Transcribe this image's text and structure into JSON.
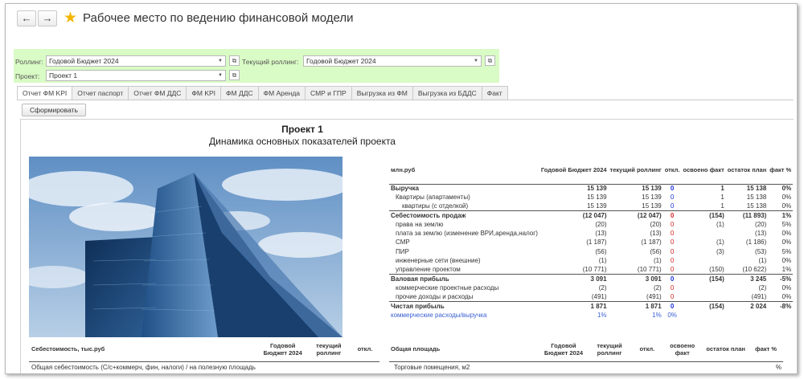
{
  "window": {
    "title": "Рабочее место по ведению финансовой модели",
    "back_icon": "←",
    "forward_icon": "→",
    "favorite_icon": "★"
  },
  "filters": {
    "rolling_label": "Роллинг:",
    "rolling_value": "Годовой Бюджет 2024",
    "current_rolling_label": "Текущий роллинг:",
    "current_rolling_value": "Годовой Бюджет 2024",
    "project_label": "Проект:",
    "project_value": "Проект 1",
    "bg_color": "#d9fbc5"
  },
  "tabs": [
    "Отчет ФМ KPI",
    "Отчет паспорт",
    "Отчет ФМ ДДС",
    "ФМ KPI",
    "ФМ ДДС",
    "ФМ Аренда",
    "СМР и ГПР",
    "Выгрузка из ФМ",
    "Выгрузка из БДДС",
    "Факт"
  ],
  "form_button": "Сформировать",
  "report": {
    "title": "Проект 1",
    "subtitle": "Динамика основных показателей проекта",
    "kpi_headers": [
      "млн.руб",
      "Годовой Бюджет 2024",
      "текущий роллинг",
      "откл.",
      "освоено факт",
      "остаток план",
      "факт %"
    ],
    "kpi_rows": [
      {
        "type": "bold",
        "cells": [
          "Выручка",
          "15 139",
          "15 139",
          "0",
          "1",
          "15 138",
          "0%"
        ],
        "dev": "blue"
      },
      {
        "type": "sub",
        "cells": [
          "Квартиры (апартаменты)",
          "15 139",
          "15 139",
          "0",
          "1",
          "15 138",
          "0%"
        ],
        "dev": "blue"
      },
      {
        "type": "sub2",
        "cells": [
          "квартиры (с отделкой)",
          "15 139",
          "15 139",
          "0",
          "1",
          "15 138",
          "0%"
        ],
        "dev": "blue"
      },
      {
        "type": "bold",
        "cells": [
          "Себестоимость продаж",
          "(12 047)",
          "(12 047)",
          "0",
          "(154)",
          "(11 893)",
          "1%"
        ],
        "dev": "red"
      },
      {
        "type": "sub",
        "cells": [
          "права на землю",
          "(20)",
          "(20)",
          "0",
          "(1)",
          "(20)",
          "5%"
        ],
        "dev": "red"
      },
      {
        "type": "sub",
        "cells": [
          "плата за землю (изменение ВРИ,аренда,налог)",
          "(13)",
          "(13)",
          "0",
          "",
          "(13)",
          "0%"
        ],
        "dev": "red"
      },
      {
        "type": "sub",
        "cells": [
          "СМР",
          "(1 187)",
          "(1 187)",
          "0",
          "(1)",
          "(1 186)",
          "0%"
        ],
        "dev": "red"
      },
      {
        "type": "sub",
        "cells": [
          "ПИР",
          "(56)",
          "(56)",
          "0",
          "(3)",
          "(53)",
          "5%"
        ],
        "dev": "red"
      },
      {
        "type": "sub",
        "cells": [
          "инженерные сети (внешние)",
          "(1)",
          "(1)",
          "0",
          "",
          "(1)",
          "0%"
        ],
        "dev": "red"
      },
      {
        "type": "sub",
        "cells": [
          "управление проектом",
          "(10 771)",
          "(10 771)",
          "0",
          "(150)",
          "(10 622)",
          "1%"
        ],
        "dev": "red"
      },
      {
        "type": "bold",
        "cells": [
          "Валовая прибыль",
          "3 091",
          "3 091",
          "0",
          "(154)",
          "3 245",
          "-5%"
        ],
        "dev": "blue"
      },
      {
        "type": "sub",
        "cells": [
          "коммерческие проектные расходы",
          "(2)",
          "(2)",
          "0",
          "",
          "(2)",
          "0%"
        ],
        "dev": "red"
      },
      {
        "type": "sub",
        "cells": [
          "прочие доходы и расходы",
          "(491)",
          "(491)",
          "0",
          "",
          "(491)",
          "0%"
        ],
        "dev": "red"
      },
      {
        "type": "bold",
        "cells": [
          "Чистая прибыль",
          "1 871",
          "1 871",
          "0",
          "(154)",
          "2 024",
          "-8%"
        ],
        "dev": "blue"
      },
      {
        "type": "link",
        "cells": [
          "коммерческие расходы/выручка",
          "1%",
          "1%",
          "0%",
          "",
          "",
          ""
        ],
        "dev": "blue"
      }
    ],
    "cost_headers": [
      "Себестоимость, тыс.руб",
      "Годовой Бюджет 2024",
      "текущий роллинг",
      "откл."
    ],
    "cost_rows": [
      [
        "Общая себестоимость (С/с+коммерч, фин, налоги) / на полезную площадь",
        "",
        "",
        ""
      ]
    ],
    "area_headers": [
      "Общая площадь",
      "Годовой Бюджет 2024",
      "текущий роллинг",
      "откл.",
      "освоено факт",
      "остаток план",
      "факт %"
    ],
    "area_rows": [
      [
        "Торговые помещения, м2",
        "",
        "",
        "",
        "",
        "",
        "%"
      ]
    ]
  }
}
